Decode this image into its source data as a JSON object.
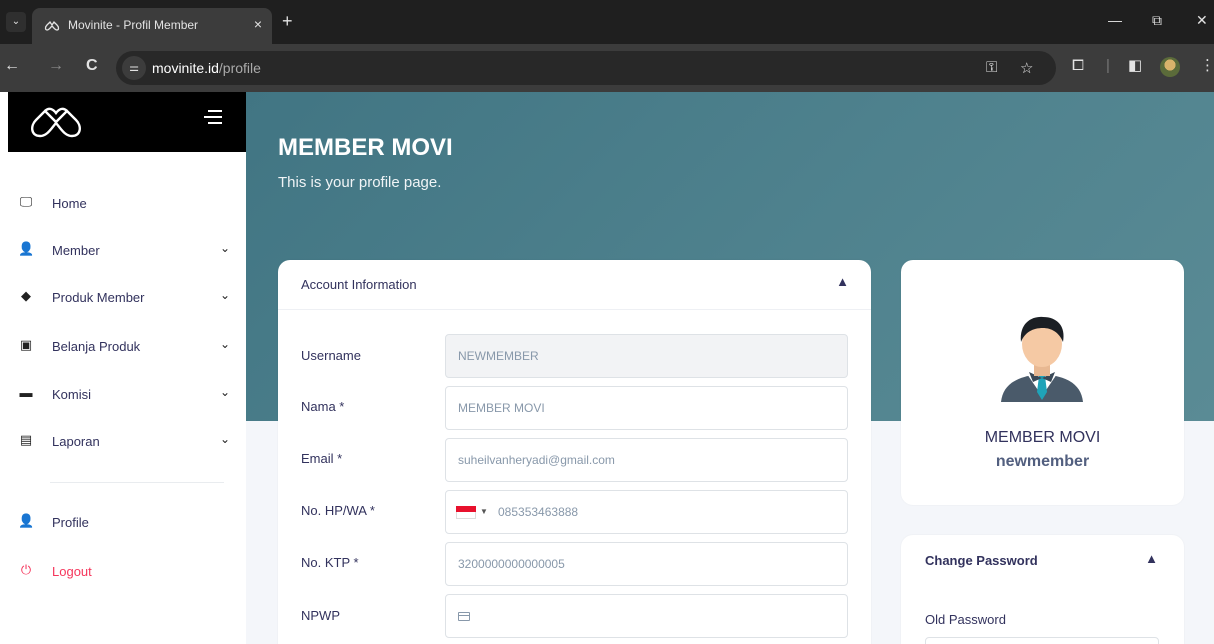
{
  "browser": {
    "tab_title": "Movinite - Profil Member",
    "tab_close": "×",
    "new_tab": "+",
    "url_host": "movinite.id",
    "url_path": "/profile",
    "minimize": "—",
    "restore": "⧉",
    "close": "✕",
    "back": "←",
    "forward": "→",
    "reload": "C"
  },
  "sidebar": {
    "items": [
      {
        "label": "Home",
        "icon": "monitor-icon"
      },
      {
        "label": "Member",
        "icon": "user-icon"
      },
      {
        "label": "Produk Member",
        "icon": "tag-icon"
      },
      {
        "label": "Belanja Produk",
        "icon": "shopping-icon"
      },
      {
        "label": "Komisi",
        "icon": "card-icon"
      },
      {
        "label": "Laporan",
        "icon": "document-icon"
      }
    ],
    "profile_label": "Profile",
    "logout_label": "Logout",
    "logout_color": "#f5365c"
  },
  "hero": {
    "title": "MEMBER MOVI",
    "subtitle": "This is your profile page."
  },
  "account": {
    "title": "Account Information",
    "fields": {
      "username": {
        "label": "Username",
        "value": "NEWMEMBER"
      },
      "nama": {
        "label": "Nama *",
        "value": "MEMBER MOVI"
      },
      "email": {
        "label": "Email *",
        "value": "suheilvanheryadi@gmail.com"
      },
      "phone": {
        "label": "No. HP/WA *",
        "value": "085353463888"
      },
      "ktp": {
        "label": "No. KTP *",
        "value": "3200000000000005"
      },
      "npwp": {
        "label": "NPWP",
        "value": ""
      }
    }
  },
  "profile_card": {
    "name": "MEMBER MOVI",
    "username": "newmember"
  },
  "change_password": {
    "title": "Change Password",
    "old_password_label": "Old Password"
  },
  "colors": {
    "hero": "#4f828e",
    "text_dark": "#32325d",
    "danger": "#f5365c"
  }
}
